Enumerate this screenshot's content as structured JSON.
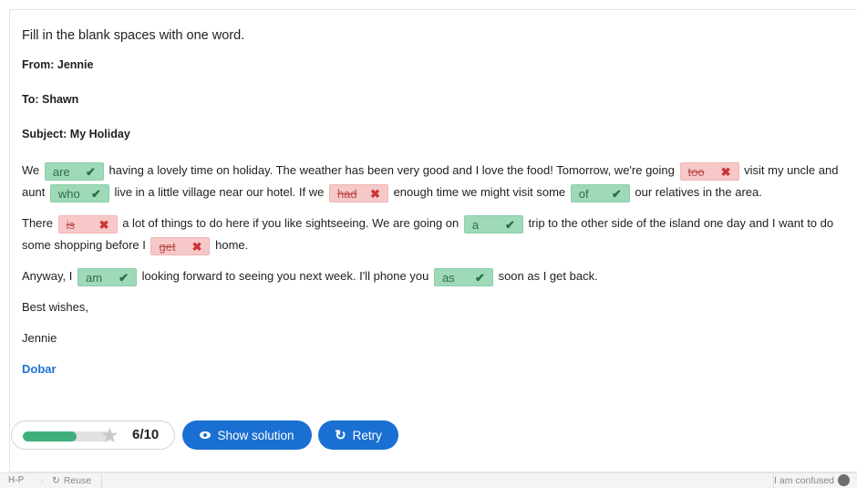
{
  "instruction": "Fill in the blank spaces with one word.",
  "email": {
    "from": "From: Jennie",
    "to": "To: Shawn",
    "subject": "Subject: My Holiday"
  },
  "para1": {
    "t1": "We ",
    "b1": "are",
    "t2": " having a lovely time on holiday. The weather has been very good and I love the food! Tomorrow, we're going ",
    "b2": "too",
    "t3": " visit my uncle and aunt ",
    "b3": "who",
    "t4": " live in a little village near our hotel. If we ",
    "b4": "had",
    "t5": " enough time we might visit some ",
    "b5": "of",
    "t6": " our relatives in the area."
  },
  "para2": {
    "t1": "There ",
    "b1": "is",
    "t2": " a lot of things to do here if you like sightseeing. We are going on ",
    "b2": "a",
    "t3": " trip to the other side of the island one day and I want to do some shopping before I ",
    "b3": "get",
    "t4": " home."
  },
  "para3": {
    "t1": "Anyway, I ",
    "b1": "am",
    "t2": " looking forward to seeing you next week. I'll phone you ",
    "b2": "as",
    "t3": " soon as I get back."
  },
  "closing": "Best wishes,",
  "signature": "Jennie",
  "feedback": "Dobar",
  "score": {
    "text": "6/10",
    "fraction": 0.6
  },
  "buttons": {
    "show_solution": "Show solution",
    "retry": "Retry"
  },
  "footer": {
    "h5p": "H-P",
    "reuse": "Reuse",
    "confused": "I am confused"
  },
  "colors": {
    "correct": "#9ed9b8",
    "wrong": "#f7c8c8",
    "button": "#1a6fd2",
    "progress": "#3fb07b"
  }
}
